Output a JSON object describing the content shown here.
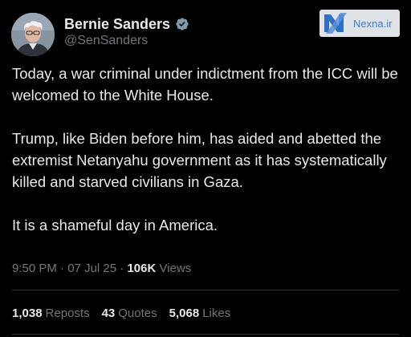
{
  "author": {
    "display_name": "Bernie Sanders",
    "handle": "@SenSanders",
    "avatar_icon": "profile-photo",
    "verified_icon": "verified-badge-icon",
    "verified_color": "#829aab"
  },
  "watermark": {
    "text": "Nexna.ir",
    "logo_icon": "nexna-logo"
  },
  "tweet": {
    "paragraphs": [
      "Today, a war criminal under indictment from the ICC will be welcomed to the White House.",
      "Trump, like Biden before him, has aided and abetted the extremist Netanyahu government as it has systematically killed and starved civilians in Gaza.",
      "It is a shameful day in America."
    ]
  },
  "meta": {
    "time": "9:50 PM",
    "separator": "·",
    "date": "07 Jul 25",
    "views_count": "106K",
    "views_label": "Views"
  },
  "stats": {
    "reposts_count": "1,038",
    "reposts_label": "Reposts",
    "quotes_count": "43",
    "quotes_label": "Quotes",
    "likes_count": "5,068",
    "likes_label": "Likes"
  },
  "colors": {
    "background": "#000000",
    "primary_text": "#e7e9ea",
    "secondary_text": "#71767b",
    "divider": "#2f3336"
  }
}
